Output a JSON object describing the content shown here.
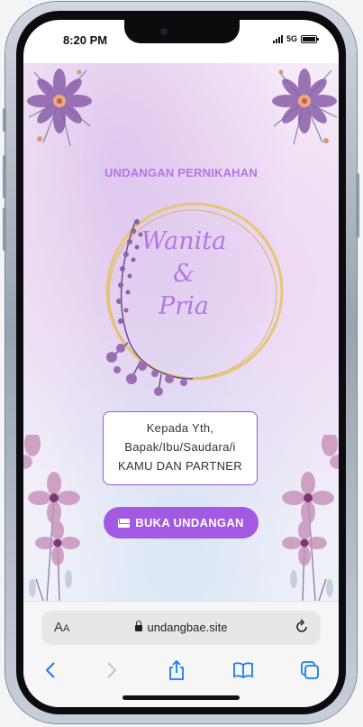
{
  "status_bar": {
    "time": "8:20 PM",
    "network": "5G"
  },
  "invitation": {
    "title": "UNDANGAN PERNIKAHAN",
    "bride": "Wanita",
    "ampersand": "&",
    "groom": "Pria",
    "recipient": {
      "line1": "Kepada Yth,",
      "line2": "Bapak/Ibu/Saudara/i",
      "line3": "KAMU DAN PARTNER"
    },
    "open_button_label": "BUKA UNDANGAN"
  },
  "browser": {
    "text_size_label": "A",
    "text_size_small": "A",
    "url": "undangbae.site"
  },
  "colors": {
    "accent": "#a25ae3",
    "title": "#b277e3"
  }
}
